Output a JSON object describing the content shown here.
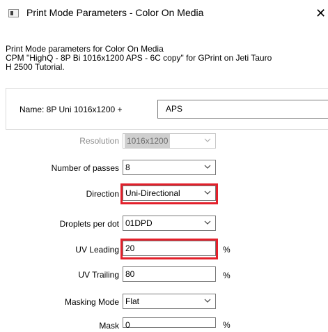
{
  "window": {
    "title": "Print Mode Parameters - Color On Media",
    "close_glyph": "✕"
  },
  "description": {
    "lines": [
      "Print Mode parameters for Color On Media",
      "CPM \"HighQ - 8P Bi 1016x1200 APS - 6C copy\" for GPrint on Jeti Tauro",
      "H 2500 Tutorial."
    ]
  },
  "name": {
    "label": "Name: 8P Uni 1016x1200 +",
    "value": "APS"
  },
  "fields": {
    "resolution": {
      "label": "Resolution",
      "value": "1016x1200",
      "enabled": false
    },
    "passes": {
      "label": "Number of passes",
      "value": "8"
    },
    "direction": {
      "label": "Direction",
      "value": "Uni-Directional",
      "highlighted": true
    },
    "droplets": {
      "label": "Droplets per dot",
      "value": "01DPD"
    },
    "uv_leading": {
      "label": "UV Leading",
      "value": "20",
      "unit": "%",
      "highlighted": true
    },
    "uv_trailing": {
      "label": "UV Trailing",
      "value": "80",
      "unit": "%"
    },
    "masking_mode": {
      "label": "Masking Mode",
      "value": "Flat"
    },
    "mask": {
      "label": "Mask",
      "value": "0",
      "unit": "%"
    }
  },
  "colors": {
    "highlight": "#e3202b",
    "border": "#7a7a7a",
    "disabled_text": "#8d8d8d"
  }
}
